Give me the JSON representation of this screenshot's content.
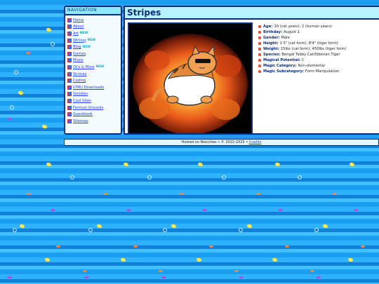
{
  "nav": {
    "heading": "NAVIGATION",
    "items": [
      {
        "label": "Home",
        "badge": ""
      },
      {
        "label": "About",
        "badge": ""
      },
      {
        "label": "Art",
        "badge": "NEW"
      },
      {
        "label": "Writing",
        "badge": "NEW"
      },
      {
        "label": "Blog",
        "badge": "NEW"
      },
      {
        "label": "Games",
        "badge": ""
      },
      {
        "label": "Music",
        "badge": ""
      },
      {
        "label": "OCs & More",
        "badge": "NEW"
      },
      {
        "label": "Shrines",
        "badge": ""
      },
      {
        "label": "Coding",
        "badge": ""
      },
      {
        "label": "UTAU Downloads",
        "badge": ""
      },
      {
        "label": "Goodies",
        "badge": ""
      },
      {
        "label": "Cool Sites",
        "badge": ""
      },
      {
        "label": "Festival Grounds",
        "badge": ""
      },
      {
        "label": "Guestbook",
        "badge": ""
      },
      {
        "label": "Sitemap",
        "badge": ""
      }
    ]
  },
  "page": {
    "title": "Stripes"
  },
  "info": [
    {
      "label": "Age:",
      "value": "30 (cat years), 2 (human years)"
    },
    {
      "label": "Birthday:",
      "value": "August 1"
    },
    {
      "label": "Gender:",
      "value": "Male"
    },
    {
      "label": "Height:",
      "value": "1'3\" (cat form), 8'4\" (tiger form)"
    },
    {
      "label": "Weight:",
      "value": "15lbs (cat form), 450lbs (tiger form)"
    },
    {
      "label": "Species:",
      "value": "Bengal Tabby Cat/Siberian Tiger"
    },
    {
      "label": "Magical Potential:",
      "value": "C"
    },
    {
      "label": "Magic Category:",
      "value": "Non-elemental"
    },
    {
      "label": "Magic Subcategory:",
      "value": "Form Manipulation"
    }
  ],
  "footer": {
    "text": "Hosted on Neocities • © 2022-2025 •",
    "link": "Credits"
  },
  "colors": {
    "accent": "#0b2d7a",
    "title_bg": "#b6f3ff",
    "link": "#1f3cff",
    "ocean": "#1a9ef0"
  }
}
